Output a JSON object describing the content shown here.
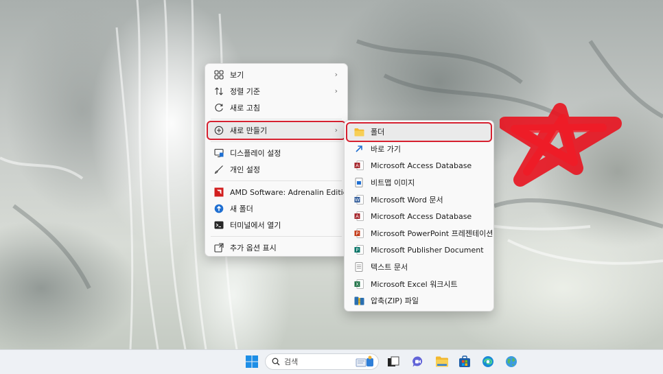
{
  "context_menu": {
    "items": [
      {
        "label": "보기",
        "icon": "view-grid-icon",
        "submenu": true
      },
      {
        "label": "정렬 기준",
        "icon": "sort-icon",
        "submenu": true
      },
      {
        "label": "새로 고침",
        "icon": "refresh-icon",
        "submenu": false
      },
      {
        "label": "새로 만들기",
        "icon": "new-plus-icon",
        "submenu": true
      },
      {
        "label": "디스플레이 설정",
        "icon": "display-icon",
        "submenu": false
      },
      {
        "label": "개인 설정",
        "icon": "brush-icon",
        "submenu": false
      },
      {
        "label": "AMD Software: Adrenalin Edition",
        "icon": "amd-icon",
        "submenu": false
      },
      {
        "label": "새 폴더",
        "icon": "new-folder-icon",
        "submenu": false
      },
      {
        "label": "터미널에서 열기",
        "icon": "terminal-icon",
        "submenu": false
      },
      {
        "label": "추가 옵션 표시",
        "icon": "more-options-icon",
        "submenu": false
      }
    ]
  },
  "new_submenu": {
    "items": [
      {
        "label": "폴더",
        "icon": "folder-icon"
      },
      {
        "label": "바로 가기",
        "icon": "shortcut-icon"
      },
      {
        "label": "Microsoft Access Database",
        "icon": "access-icon"
      },
      {
        "label": "비트맵 이미지",
        "icon": "bitmap-icon"
      },
      {
        "label": "Microsoft Word 문서",
        "icon": "word-icon"
      },
      {
        "label": "Microsoft Access Database",
        "icon": "access-icon"
      },
      {
        "label": "Microsoft PowerPoint 프레젠테이션",
        "icon": "powerpoint-icon"
      },
      {
        "label": "Microsoft Publisher Document",
        "icon": "publisher-icon"
      },
      {
        "label": "텍스트 문서",
        "icon": "text-document-icon"
      },
      {
        "label": "Microsoft Excel 워크시트",
        "icon": "excel-icon"
      },
      {
        "label": "압축(ZIP) 파일",
        "icon": "zip-icon"
      }
    ]
  },
  "taskbar": {
    "search_placeholder": "검색"
  },
  "colors": {
    "highlight_box": "#d6202f",
    "star_mark": "#e8131f"
  }
}
